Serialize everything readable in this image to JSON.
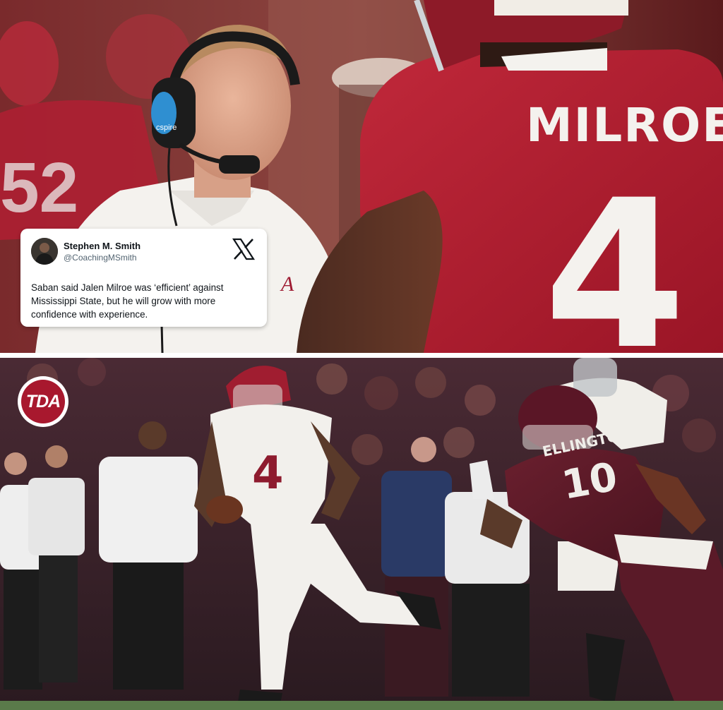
{
  "top_photo": {
    "jersey_name": "MILROE",
    "jersey_number": "4",
    "background_jersey_number": "52",
    "headset_brand": "cspire"
  },
  "tweet": {
    "author_name": "Stephen M. Smith",
    "author_handle": "@CoachingMSmith",
    "platform_icon": "x-logo-icon",
    "text": "Saban said Jalen Milroe was ‘efficient’ against Mississippi State, but he will grow with more confidence with experience."
  },
  "bottom_photo": {
    "logo_text": "TDA",
    "qb_number": "4",
    "defender_name": "ELLINGTON",
    "defender_number": "10"
  },
  "colors": {
    "crimson": "#9e1b32",
    "maroon": "#5d1725",
    "white": "#ffffff"
  }
}
